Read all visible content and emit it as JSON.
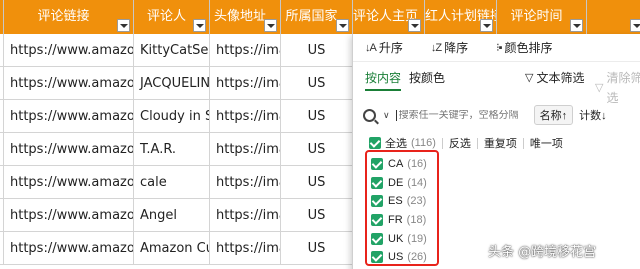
{
  "headers": [
    "评论链接",
    "评论人",
    "头像地址",
    "所属国家",
    "评论人主页",
    "红人计划链接",
    "评论时间",
    ""
  ],
  "rows": [
    [
      "https://www.amazon.c",
      "KittyCatSeni",
      "https://imag",
      "US"
    ],
    [
      "https://www.amazon.c",
      "JACQUELINE",
      "https://imag",
      "US"
    ],
    [
      "https://www.amazon.c",
      "Cloudy in Se",
      "https://imag",
      "US"
    ],
    [
      "https://www.amazon.c",
      "T.A.R.",
      "https://imag",
      "US"
    ],
    [
      "https://www.amazon.c",
      "cale",
      "https://imag",
      "US"
    ],
    [
      "https://www.amazon.c",
      "Angel",
      "https://imag",
      "US"
    ],
    [
      "https://www.amazon.c",
      "Amazon Cus",
      "https://imag",
      "US"
    ]
  ],
  "filter_panel": {
    "sort": {
      "asc": "升序",
      "desc": "降序",
      "color": "颜色排序"
    },
    "tabs": {
      "content": "按内容",
      "color": "按颜色",
      "text_filter": "文本筛选",
      "clear": "清除筛选"
    },
    "search": {
      "placeholder": "搜索任一关键字，空格分隔",
      "sort_name": "名称↑",
      "sort_count": "计数↓"
    },
    "select_all": {
      "label": "全选",
      "count": "(116)"
    },
    "actions": {
      "invert": "反选",
      "duplicates": "重复项",
      "unique": "唯一项"
    },
    "items": [
      {
        "code": "CA",
        "count": "(16)"
      },
      {
        "code": "DE",
        "count": "(14)"
      },
      {
        "code": "ES",
        "count": "(23)"
      },
      {
        "code": "FR",
        "count": "(18)"
      },
      {
        "code": "UK",
        "count": "(19)"
      },
      {
        "code": "US",
        "count": "(26)"
      }
    ]
  },
  "watermark": "头条 @跨境移花宫",
  "colors": {
    "header_bg": "#f0900c",
    "accent": "#1a7f37",
    "checkbox": "#21a366",
    "highlight": "#e8231b"
  },
  "icons": {
    "search": "search-icon",
    "filter": "filter-dropdown-icon"
  }
}
